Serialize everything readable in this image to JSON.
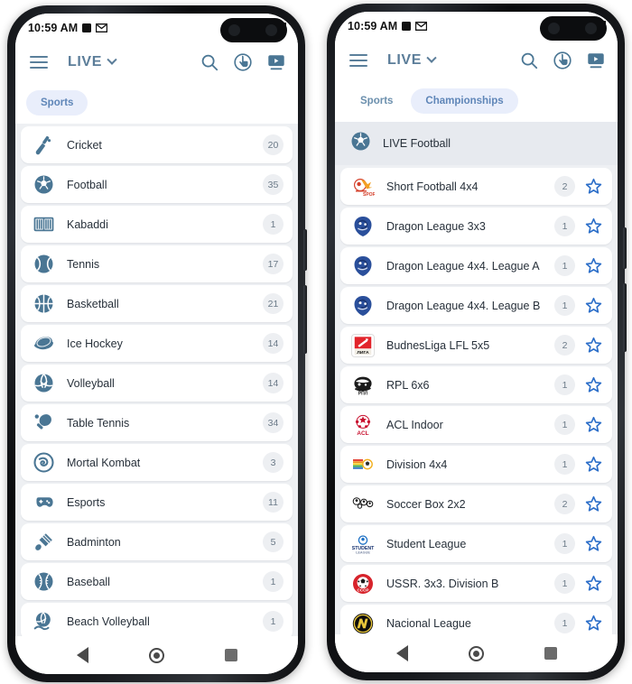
{
  "status_bar": {
    "time": "10:59 AM",
    "icons": [
      "square-indicator-icon",
      "gmail-icon"
    ],
    "signal": "signal-bars-icon"
  },
  "toolbar": {
    "menu_icon": "hamburger-menu-icon",
    "title": "LIVE",
    "dropdown_icon": "chevron-down-icon",
    "actions": [
      "search-icon",
      "touch-bet-icon",
      "tv-broadcast-icon"
    ]
  },
  "nav_bar": {
    "back": "back-triangle-icon",
    "home": "home-circle-icon",
    "recents": "recents-square-icon"
  },
  "left_phone": {
    "tabs": [
      {
        "label": "Sports",
        "active": true
      },
      {
        "label": "Championships",
        "active": false
      }
    ],
    "items": [
      {
        "name": "Cricket",
        "count": "20",
        "icon": "cricket-bat-icon"
      },
      {
        "name": "Football",
        "count": "35",
        "icon": "football-ball-icon"
      },
      {
        "name": "Kabaddi",
        "count": "1",
        "icon": "kabaddi-court-icon"
      },
      {
        "name": "Tennis",
        "count": "17",
        "icon": "tennis-ball-icon"
      },
      {
        "name": "Basketball",
        "count": "21",
        "icon": "basketball-icon"
      },
      {
        "name": "Ice Hockey",
        "count": "14",
        "icon": "hockey-puck-icon"
      },
      {
        "name": "Volleyball",
        "count": "14",
        "icon": "volleyball-icon"
      },
      {
        "name": "Table Tennis",
        "count": "34",
        "icon": "table-tennis-paddle-icon"
      },
      {
        "name": "Mortal Kombat",
        "count": "3",
        "icon": "mortal-kombat-dragon-icon"
      },
      {
        "name": "Esports",
        "count": "11",
        "icon": "gamepad-icon"
      },
      {
        "name": "Badminton",
        "count": "5",
        "icon": "shuttlecock-icon"
      },
      {
        "name": "Baseball",
        "count": "1",
        "icon": "baseball-icon"
      },
      {
        "name": "Beach Volleyball",
        "count": "1",
        "icon": "beach-volleyball-icon"
      }
    ]
  },
  "right_phone": {
    "tabs": [
      {
        "label": "Sports",
        "active": false
      },
      {
        "label": "Championships",
        "active": true
      }
    ],
    "group_header": {
      "label": "LIVE Football",
      "icon": "football-ball-icon"
    },
    "items": [
      {
        "name": "Short Football 4x4",
        "count": "2",
        "icon": "short-football-logo",
        "star": "star-outline-icon"
      },
      {
        "name": "Dragon League 3x3",
        "count": "1",
        "icon": "dragon-league-logo",
        "star": "star-outline-icon"
      },
      {
        "name": "Dragon League 4x4. League A",
        "count": "1",
        "icon": "dragon-league-logo",
        "star": "star-outline-icon"
      },
      {
        "name": "Dragon League 4x4. League B",
        "count": "1",
        "icon": "dragon-league-logo",
        "star": "star-outline-icon"
      },
      {
        "name": "BudnesLiga LFL 5x5",
        "count": "2",
        "icon": "budnesliga-logo",
        "star": "star-outline-icon"
      },
      {
        "name": "RPL 6x6",
        "count": "1",
        "icon": "rpl-logo",
        "star": "star-outline-icon"
      },
      {
        "name": "ACL Indoor",
        "count": "1",
        "icon": "acl-logo",
        "star": "star-outline-icon"
      },
      {
        "name": "Division 4x4",
        "count": "1",
        "icon": "division-logo",
        "star": "star-outline-icon"
      },
      {
        "name": "Soccer Box 2x2",
        "count": "2",
        "icon": "soccer-box-logo",
        "star": "star-outline-icon"
      },
      {
        "name": "Student League",
        "count": "1",
        "icon": "student-league-logo",
        "star": "star-outline-icon"
      },
      {
        "name": "USSR. 3x3. Division B",
        "count": "1",
        "icon": "ussr-logo",
        "star": "star-outline-icon"
      },
      {
        "name": "Nacional League",
        "count": "1",
        "icon": "nacional-league-logo",
        "star": "star-outline-icon"
      }
    ]
  },
  "colors": {
    "accent_blue": "#5b7d99",
    "sport_icon": "#4a7694",
    "star_blue": "#2d6fc9",
    "chip_active_bg": "#e9eefb",
    "chip_text": "#6b8fad",
    "page_bg": "#eef0f3",
    "badge_bg": "#edeff2",
    "row_text": "#27303a"
  }
}
